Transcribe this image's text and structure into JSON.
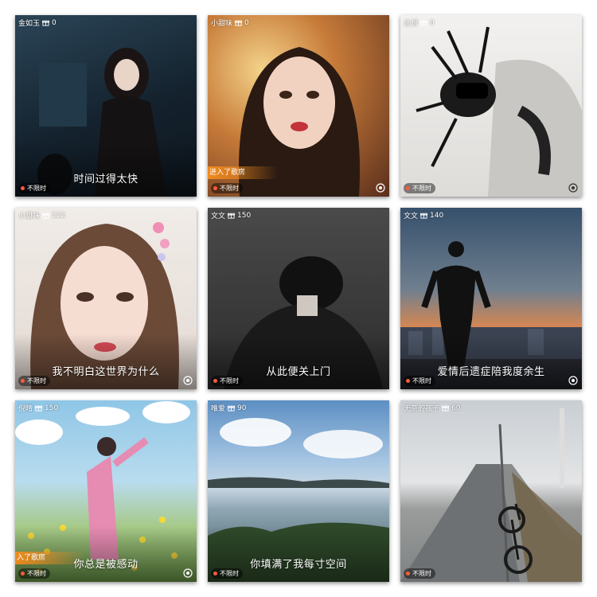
{
  "cards": [
    {
      "user": "金如玉",
      "count": "0",
      "caption": "时间过得太快",
      "time": "不限时",
      "tag": ""
    },
    {
      "user": "小甜味",
      "count": "0",
      "caption": "",
      "time": "不限时",
      "tag": "进入了歌房"
    },
    {
      "user": "念想",
      "count": "0",
      "caption": "",
      "time": "不限时",
      "tag": ""
    },
    {
      "user": "小甜味",
      "count": "222",
      "caption": "我不明白这世界为什么",
      "time": "不限时",
      "tag": ""
    },
    {
      "user": "文文",
      "count": "150",
      "caption": "从此便关上门",
      "time": "不限时",
      "tag": ""
    },
    {
      "user": "文文",
      "count": "140",
      "caption": "爱情后遗症陪我度余生",
      "time": "不限时",
      "tag": ""
    },
    {
      "user": "倪晴",
      "count": "150",
      "caption": "你总是被感动",
      "time": "不限时",
      "tag": "入了歌房"
    },
    {
      "user": "唯爱",
      "count": "90",
      "caption": "你填满了我每寸空间",
      "time": "不限时",
      "tag": ""
    },
    {
      "user": "无奈的孩子",
      "count": "60",
      "caption": "",
      "time": "不限时",
      "tag": ""
    }
  ],
  "icons": {
    "gift": "gift-icon",
    "audio": "audio-wave-icon"
  },
  "colors": {
    "live_dot": "#ff5a3c",
    "tag": "#f08a1d"
  }
}
